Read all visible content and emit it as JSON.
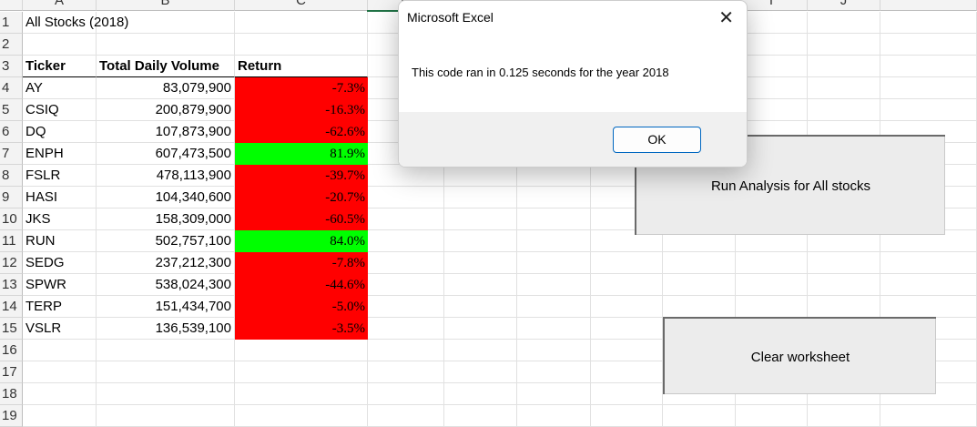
{
  "sheet": {
    "columns": [
      "A",
      "B",
      "C",
      "D",
      "E",
      "F",
      "G",
      "H",
      "I",
      "J",
      ""
    ],
    "row_numbers": [
      "1",
      "2",
      "3",
      "4",
      "5",
      "6",
      "7",
      "8",
      "9",
      "10",
      "11",
      "12",
      "13",
      "14",
      "15",
      "16",
      "17",
      "18",
      "19"
    ],
    "title": "All Stocks (2018)",
    "headers": [
      "Ticker",
      "Total Daily Volume",
      "Return"
    ],
    "rows": [
      {
        "ticker": "AY",
        "volume": "83,079,900",
        "return": "-7.3%",
        "positive": false
      },
      {
        "ticker": "CSIQ",
        "volume": "200,879,900",
        "return": "-16.3%",
        "positive": false
      },
      {
        "ticker": "DQ",
        "volume": "107,873,900",
        "return": "-62.6%",
        "positive": false
      },
      {
        "ticker": "ENPH",
        "volume": "607,473,500",
        "return": "81.9%",
        "positive": true
      },
      {
        "ticker": "FSLR",
        "volume": "478,113,900",
        "return": "-39.7%",
        "positive": false
      },
      {
        "ticker": "HASI",
        "volume": "104,340,600",
        "return": "-20.7%",
        "positive": false
      },
      {
        "ticker": "JKS",
        "volume": "158,309,000",
        "return": "-60.5%",
        "positive": false
      },
      {
        "ticker": "RUN",
        "volume": "502,757,100",
        "return": "84.0%",
        "positive": true
      },
      {
        "ticker": "SEDG",
        "volume": "237,212,300",
        "return": "-7.8%",
        "positive": false
      },
      {
        "ticker": "SPWR",
        "volume": "538,024,300",
        "return": "-44.6%",
        "positive": false
      },
      {
        "ticker": "TERP",
        "volume": "151,434,700",
        "return": "-5.0%",
        "positive": false
      },
      {
        "ticker": "VSLR",
        "volume": "136,539,100",
        "return": "-3.5%",
        "positive": false
      }
    ],
    "colors": {
      "positive": "#00ff00",
      "negative": "#ff0000",
      "header_bg": "#f3f3f3",
      "accent": "#217346"
    }
  },
  "dialog": {
    "title": "Microsoft Excel",
    "close_icon": "x-icon",
    "message": "This code ran in 0.125 seconds for the year 2018",
    "ok_label": "OK"
  },
  "buttons": {
    "run_analysis": "Run Analysis for All stocks",
    "clear": "Clear worksheet"
  }
}
